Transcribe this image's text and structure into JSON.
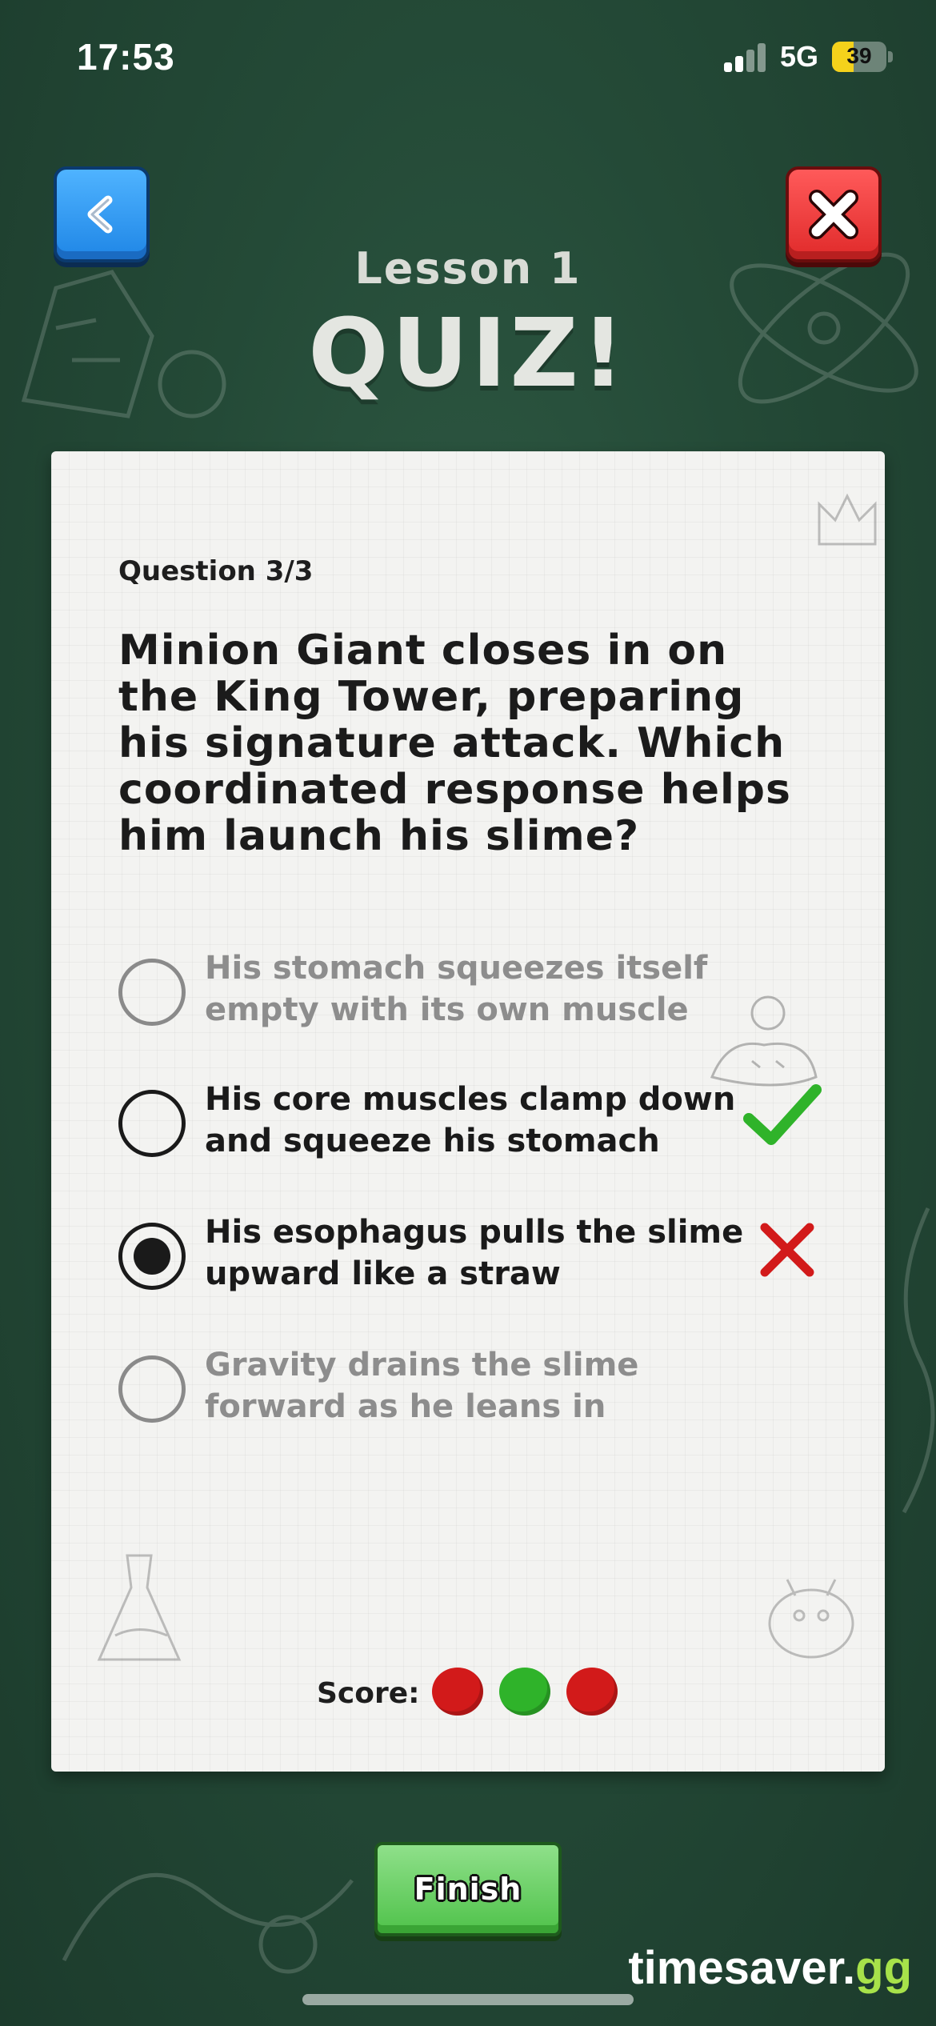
{
  "status_bar": {
    "time": "17:53",
    "network": "5G",
    "battery_level": "39",
    "battery_fraction": 0.39
  },
  "nav": {
    "back_icon": "chevron-left-icon",
    "close_icon": "close-x-icon"
  },
  "header": {
    "lesson": "Lesson 1",
    "title": "QUIZ!"
  },
  "question": {
    "counter": "Question 3/3",
    "text": "Minion Giant closes in on the King Tower, preparing his signature attack. Which coordinated response helps him launch his slime?"
  },
  "options": [
    {
      "text": "His stomach squeezes itself empty with its own muscle",
      "selected": false,
      "state": "neutral"
    },
    {
      "text": "His core muscles clamp down and squeeze his stomach",
      "selected": false,
      "state": "correct"
    },
    {
      "text": "His esophagus pulls the slime upward like a straw",
      "selected": true,
      "state": "wrong"
    },
    {
      "text": "Gravity drains the slime forward as he leans in",
      "selected": false,
      "state": "neutral"
    }
  ],
  "score": {
    "label": "Score:",
    "results": [
      "wrong",
      "correct",
      "wrong"
    ],
    "colors": {
      "correct": "#2fb32a",
      "wrong": "#d21a1a"
    }
  },
  "footer": {
    "finish_label": "Finish",
    "watermark_main": "timesaver.",
    "watermark_accent": "gg"
  },
  "colors": {
    "background": "#244a37",
    "card": "#f3f3f1",
    "back_button": "#2d96f2",
    "close_button": "#e83434",
    "finish_button": "#5fcb5a",
    "correct_mark": "#2fb32a",
    "wrong_mark": "#d21a1a"
  }
}
